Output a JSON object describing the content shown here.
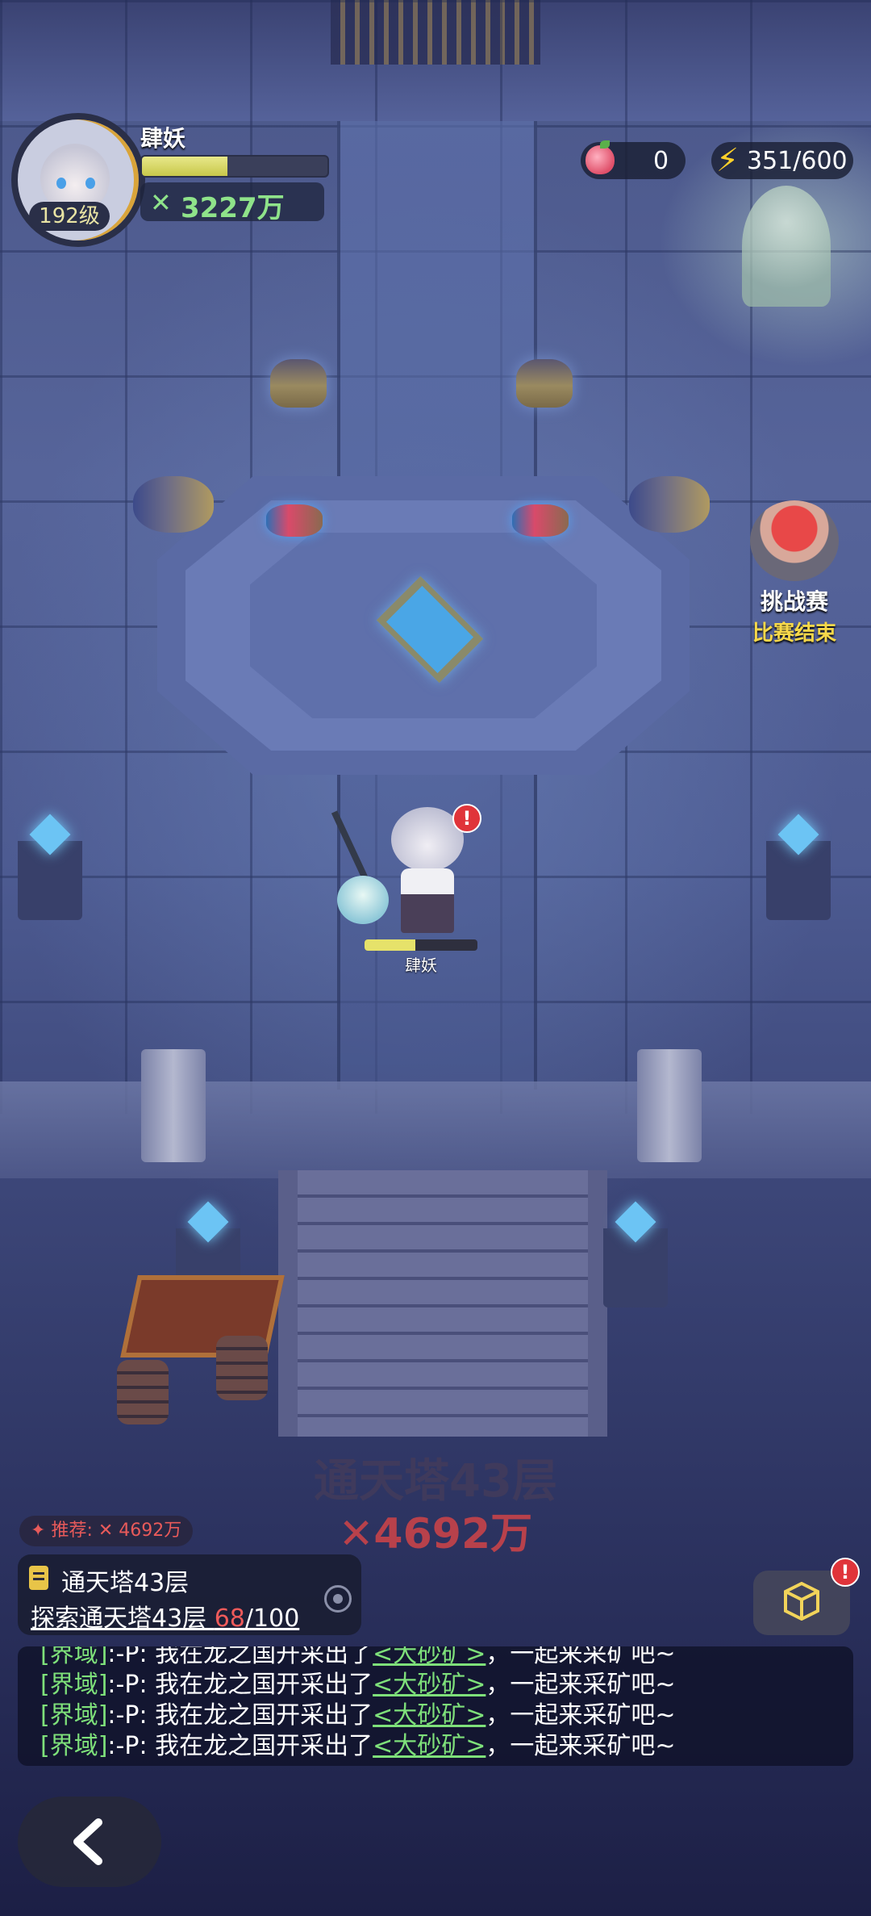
{
  "player": {
    "name": "肆妖",
    "level": "192级",
    "exp_fraction": 0.46,
    "power": "3227万"
  },
  "resources": {
    "peach": "0",
    "stamina": "351/600"
  },
  "challenge": {
    "title": "挑战赛",
    "status": "比赛结束"
  },
  "hero": {
    "name": "肆妖",
    "hp_fraction": 0.45
  },
  "floor": {
    "title": "通天塔43层",
    "power": "4692万"
  },
  "recommend": {
    "label": "推荐:",
    "value": "4692万"
  },
  "quest": {
    "title": "通天塔43层",
    "desc": "探索通天塔43层 ",
    "progress_current": "68",
    "progress_total": "/100"
  },
  "chat": {
    "lines": [
      {
        "channel": "[界域]",
        "text": ":-P: 我在龙之国开采出了",
        "link": "<大砂矿>",
        "tail": "，一起来采矿吧~"
      },
      {
        "channel": "[界域]",
        "text": ":-P: 我在龙之国开采出了",
        "link": "<大砂矿>",
        "tail": "，一起来采矿吧~"
      },
      {
        "channel": "[界域]",
        "text": ":-P: 我在龙之国开采出了",
        "link": "<大砂矿>",
        "tail": "，一起来采矿吧~"
      },
      {
        "channel": "[界域]",
        "text": ":-P: 我在龙之国开采出了",
        "link": "<大砂矿>",
        "tail": "，一起来采矿吧~"
      }
    ]
  },
  "alerts": {
    "hero": "!",
    "cube": "!"
  },
  "colors": {
    "power_green": "#8fe38a",
    "quest_red": "#ee5a5a",
    "challenge_yellow": "#f6d84a",
    "chat_green": "#7ee07a"
  }
}
